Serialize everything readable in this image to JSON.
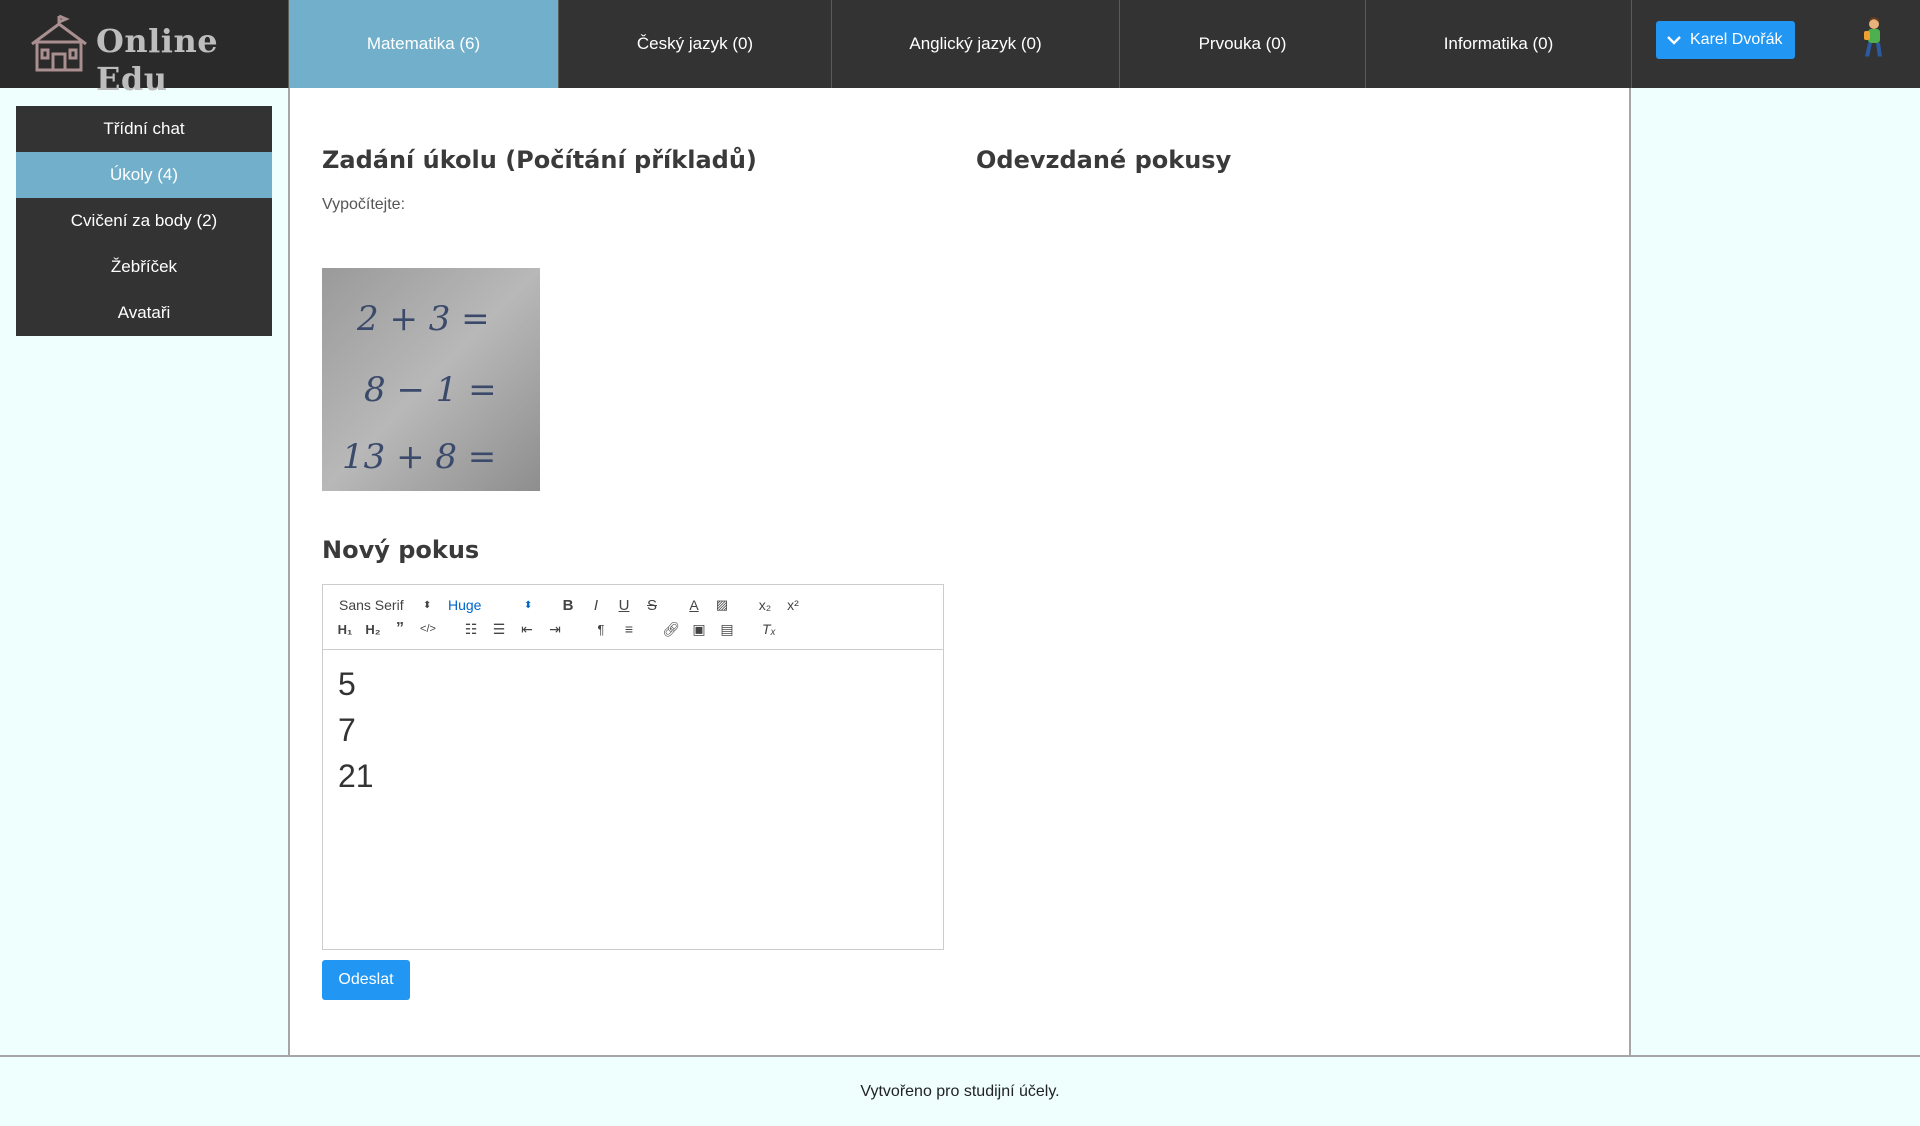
{
  "app": {
    "logo_text": "Online Edu"
  },
  "subjects": [
    {
      "label": "Matematika (6)",
      "active": true
    },
    {
      "label": "Český jazyk (0)"
    },
    {
      "label": "Anglický jazyk (0)"
    },
    {
      "label": "Prvouka (0)"
    },
    {
      "label": "Informatika (0)"
    }
  ],
  "user": {
    "name": "Karel Dvořák"
  },
  "sidebar": {
    "items": [
      {
        "label": "Třídní chat"
      },
      {
        "label": "Úkoly (4)",
        "active": true
      },
      {
        "label": "Cvičení za body (2)"
      },
      {
        "label": "Žebříček"
      },
      {
        "label": "Avataři"
      }
    ]
  },
  "task": {
    "title": "Zadání úkolu (Počítání příkladů)",
    "description": "Vypočítejte:",
    "image_lines": [
      "2 + 3 =",
      "8 − 1 =",
      "13 + 8 ="
    ]
  },
  "attempts": {
    "title": "Odevzdané pokusy"
  },
  "new_attempt": {
    "title": "Nový pokus",
    "font_select": "Sans Serif",
    "size_select": "Huge",
    "content_lines": [
      "5",
      "7",
      "21"
    ],
    "submit_label": "Odeslat"
  },
  "footer": {
    "text": "Vytvořeno pro studijní účely."
  },
  "colors": {
    "topbar": "#333333",
    "accent": "#72afcb",
    "primary": "#2196f3",
    "page_bg": "#eefffe"
  }
}
